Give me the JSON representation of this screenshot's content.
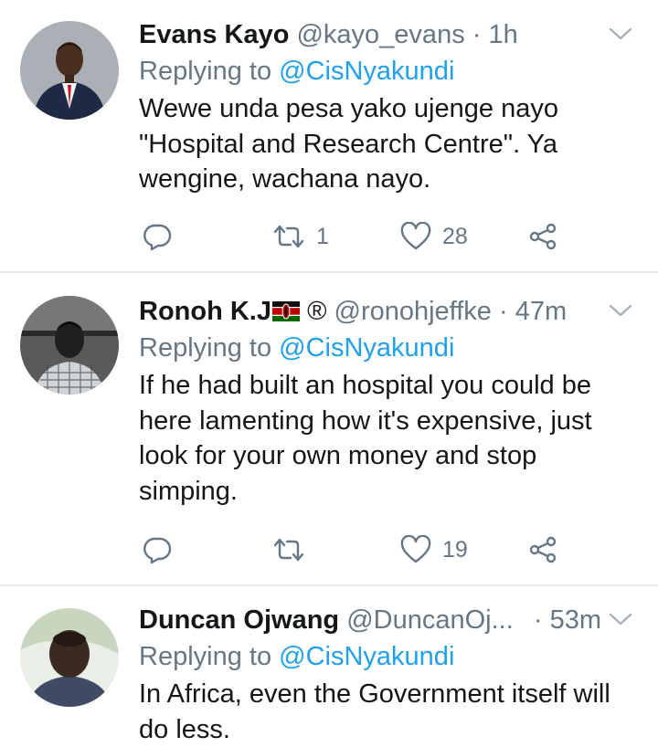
{
  "tweets": [
    {
      "name": "Evans Kayo",
      "handle": "@kayo_evans",
      "separator": "·",
      "time": "1h",
      "replying_prefix": "Replying to",
      "replying_to": "@CisNyakundi",
      "text": "Wewe unda pesa yako ujenge nayo \"Hospital and Research Centre\". Ya wengine, wachana nayo.",
      "retweets": "1",
      "likes": "28"
    },
    {
      "name": "Ronoh K.J",
      "flag": "kenya-flag-icon",
      "registered": "®",
      "handle": "@ronohjeffke",
      "separator": "·",
      "time": "47m",
      "replying_prefix": "Replying to",
      "replying_to": "@CisNyakundi",
      "text": "If he had built an hospital you could be here lamenting how it's expensive, just look for your own money and stop simping.",
      "retweets": "",
      "likes": "19"
    },
    {
      "name": "Duncan Ojwang",
      "handle": "@DuncanOj...",
      "separator": "·",
      "time": "53m",
      "replying_prefix": "Replying to",
      "replying_to": "@CisNyakundi",
      "text": "In Africa, even the Government itself will do less."
    }
  ],
  "colors": {
    "text_primary": "#14171a",
    "text_secondary": "#657786",
    "link": "#1da1f2",
    "divider": "#e6ecf0"
  }
}
